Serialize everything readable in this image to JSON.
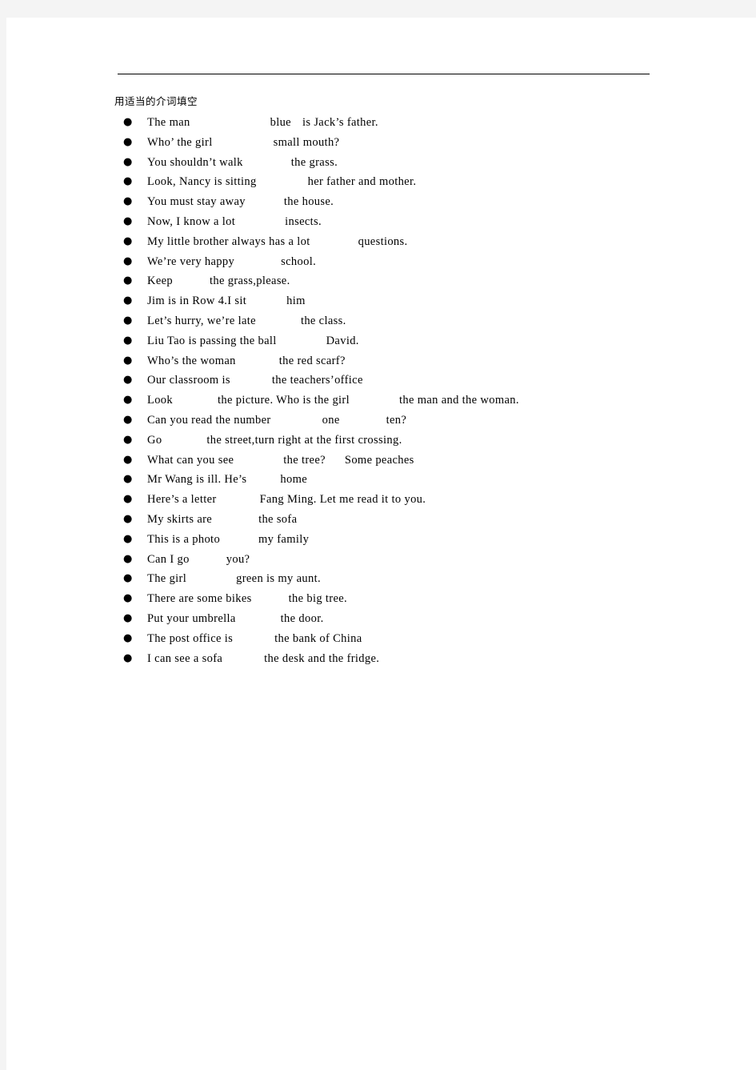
{
  "document": {
    "heading": "用适当的介词填空",
    "bullet_glyph": "●",
    "text_color": "#000000",
    "page_background": "#ffffff",
    "canvas_background": "#f4f4f4",
    "rule_color": "#000000"
  },
  "items": [
    {
      "index": 1,
      "text": "The man            blue    is Jack’s father.",
      "segments": [
        {
          "text": "The man",
          "gap_after": 100
        },
        {
          "text": "blue",
          "gap_after": 14
        },
        {
          "text": "is Jack’s father.",
          "gap_after": 0
        }
      ]
    },
    {
      "index": 2,
      "text": "Who’ the girl           small mouth?",
      "segments": [
        {
          "text": "Who’ the girl",
          "gap_after": 76
        },
        {
          "text": "small mouth?",
          "gap_after": 0
        }
      ]
    },
    {
      "index": 3,
      "text": "You shouldn’t walk         the grass.",
      "segments": [
        {
          "text": "You shouldn’t walk",
          "gap_after": 60
        },
        {
          "text": "the grass.",
          "gap_after": 0
        }
      ]
    },
    {
      "index": 4,
      "text": "Look, Nancy is sitting          her father and mother.",
      "segments": [
        {
          "text": "Look, Nancy is sitting",
          "gap_after": 64
        },
        {
          "text": "her father and mother.",
          "gap_after": 0
        }
      ]
    },
    {
      "index": 5,
      "text": "You must stay away        the house.",
      "segments": [
        {
          "text": "You must stay away",
          "gap_after": 48
        },
        {
          "text": "the house.",
          "gap_after": 0
        }
      ]
    },
    {
      "index": 6,
      "text": "Now, I know a lot        insects.",
      "segments": [
        {
          "text": "Now, I know a lot",
          "gap_after": 62
        },
        {
          "text": "insects.",
          "gap_after": 0
        }
      ]
    },
    {
      "index": 7,
      "text": "My little brother always has a lot        questions.",
      "segments": [
        {
          "text": "My little brother always has a lot",
          "gap_after": 60
        },
        {
          "text": "questions.",
          "gap_after": 0
        }
      ]
    },
    {
      "index": 8,
      "text": "We’re very happy       school.",
      "segments": [
        {
          "text": "We’re very happy",
          "gap_after": 58
        },
        {
          "text": "school.",
          "gap_after": 0
        }
      ]
    },
    {
      "index": 9,
      "text": "Keep       the grass,please.",
      "segments": [
        {
          "text": "Keep",
          "gap_after": 46
        },
        {
          "text": "the grass,please.",
          "gap_after": 0
        }
      ]
    },
    {
      "index": 10,
      "text": "Jim is in Row 4.I sit        him",
      "segments": [
        {
          "text": "Jim is in Row 4.I sit",
          "gap_after": 50
        },
        {
          "text": "him",
          "gap_after": 0
        }
      ]
    },
    {
      "index": 11,
      "text": "Let’s hurry, we’re late       the class.",
      "segments": [
        {
          "text": "Let’s hurry, we’re late",
          "gap_after": 56
        },
        {
          "text": "the class.",
          "gap_after": 0
        }
      ]
    },
    {
      "index": 12,
      "text": "Liu Tao is passing the ball        David.",
      "segments": [
        {
          "text": "Liu Tao is passing the ball",
          "gap_after": 62
        },
        {
          "text": "David.",
          "gap_after": 0
        }
      ]
    },
    {
      "index": 13,
      "text": "Who’s the woman        the red scarf?",
      "segments": [
        {
          "text": "Who’s the woman",
          "gap_after": 54
        },
        {
          "text": "the red scarf?",
          "gap_after": 0
        }
      ]
    },
    {
      "index": 14,
      "text": "Our classroom is       the teachers’office",
      "segments": [
        {
          "text": "Our classroom is",
          "gap_after": 52
        },
        {
          "text": "the teachers’office",
          "gap_after": 0
        }
      ]
    },
    {
      "index": 15,
      "text": "Look        the picture. Who is the girl        the man and the woman.",
      "segments": [
        {
          "text": "Look",
          "gap_after": 56
        },
        {
          "text": "the picture. Who is the girl",
          "gap_after": 62
        },
        {
          "text": "the man and the woman.",
          "gap_after": 0
        }
      ]
    },
    {
      "index": 16,
      "text": "Can you read the number        one        ten?",
      "segments": [
        {
          "text": "Can you read the number",
          "gap_after": 64
        },
        {
          "text": "one",
          "gap_after": 58
        },
        {
          "text": "ten?",
          "gap_after": 0
        }
      ]
    },
    {
      "index": 17,
      "text": "Go        the street,turn right at the first crossing.",
      "segments": [
        {
          "text": "Go",
          "gap_after": 56
        },
        {
          "text": "the street,turn right at the first crossing.",
          "gap_after": 0
        }
      ]
    },
    {
      "index": 18,
      "text": "What can you see        the tree?   Some peaches",
      "segments": [
        {
          "text": "What can you see",
          "gap_after": 62
        },
        {
          "text": "the tree?",
          "gap_after": 24
        },
        {
          "text": "Some peaches",
          "gap_after": 0
        }
      ]
    },
    {
      "index": 19,
      "text": "Mr Wang is ill. He’s       home",
      "segments": [
        {
          "text": "Mr Wang is ill. He’s",
          "gap_after": 42
        },
        {
          "text": "home",
          "gap_after": 0
        }
      ]
    },
    {
      "index": 20,
      "text": "Here’s a letter       Fang Ming. Let me read it to you.",
      "segments": [
        {
          "text": "Here’s a letter",
          "gap_after": 54
        },
        {
          "text": "Fang Ming. Let me read it to you.",
          "gap_after": 0
        }
      ]
    },
    {
      "index": 21,
      "text": "My skirts are        the sofa",
      "segments": [
        {
          "text": "My skirts are",
          "gap_after": 58
        },
        {
          "text": "the sofa",
          "gap_after": 0
        }
      ]
    },
    {
      "index": 22,
      "text": "This is a photo       my family",
      "segments": [
        {
          "text": "This is a photo",
          "gap_after": 48
        },
        {
          "text": "my family",
          "gap_after": 0
        }
      ]
    },
    {
      "index": 23,
      "text": "Can I go       you?",
      "segments": [
        {
          "text": "Can I go",
          "gap_after": 46
        },
        {
          "text": "you?",
          "gap_after": 0
        }
      ]
    },
    {
      "index": 24,
      "text": "The girl         green is my aunt.",
      "segments": [
        {
          "text": "The girl",
          "gap_after": 62
        },
        {
          "text": "green is my aunt.",
          "gap_after": 0
        }
      ]
    },
    {
      "index": 25,
      "text": "There are some bikes       the big tree.",
      "segments": [
        {
          "text": "There are some bikes",
          "gap_after": 46
        },
        {
          "text": "the big tree.",
          "gap_after": 0
        }
      ]
    },
    {
      "index": 26,
      "text": "Put your umbrella        the door.",
      "segments": [
        {
          "text": "Put your umbrella",
          "gap_after": 56
        },
        {
          "text": "the door.",
          "gap_after": 0
        }
      ]
    },
    {
      "index": 27,
      "text": "The post office is       the bank of China",
      "segments": [
        {
          "text": "The post office is",
          "gap_after": 52
        },
        {
          "text": "the bank of China",
          "gap_after": 0
        }
      ]
    },
    {
      "index": 28,
      "text": "I can see a sofa       the desk and the fridge.",
      "segments": [
        {
          "text": "I can see a sofa",
          "gap_after": 52
        },
        {
          "text": "the desk and the fridge.",
          "gap_after": 0
        }
      ]
    }
  ]
}
